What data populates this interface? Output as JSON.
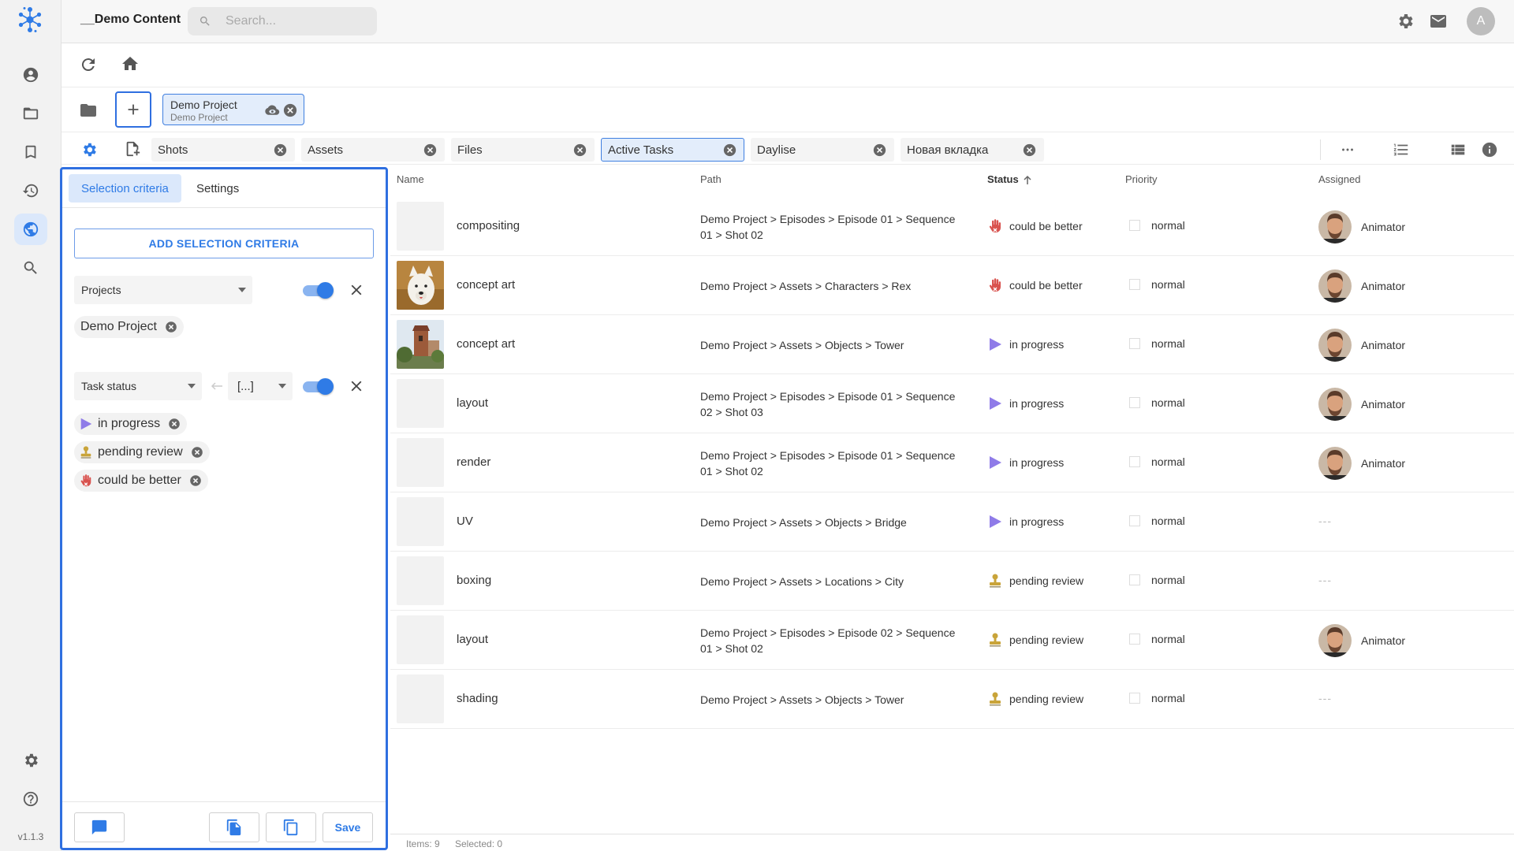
{
  "app": {
    "title": "__Demo Content",
    "version": "v1.1.3",
    "avatar_initial": "A",
    "accent": "#2f7be6"
  },
  "search": {
    "placeholder": "Search..."
  },
  "project_chip": {
    "name": "Demo Project",
    "subtitle": "Demo Project"
  },
  "tabs": [
    {
      "label": "Shots",
      "active": false
    },
    {
      "label": "Assets",
      "active": false
    },
    {
      "label": "Files",
      "active": false
    },
    {
      "label": "Active Tasks",
      "active": true
    },
    {
      "label": "Daylise",
      "active": false
    },
    {
      "label": "Новая вкладка",
      "active": false
    }
  ],
  "panel": {
    "tabs": [
      {
        "label": "Selection criteria",
        "active": true
      },
      {
        "label": "Settings",
        "active": false
      }
    ],
    "add_button": "ADD SELECTION CRITERIA",
    "criteria": [
      {
        "field": "Projects",
        "enabled": true,
        "values": [
          "Demo Project"
        ]
      },
      {
        "field": "Task status",
        "operator": "[...]",
        "enabled": true,
        "values": [
          "in progress",
          "pending review",
          "could be better"
        ]
      }
    ],
    "save_label": "Save"
  },
  "table": {
    "columns": {
      "name": "Name",
      "path": "Path",
      "status": "Status",
      "priority": "Priority",
      "assigned": "Assigned"
    },
    "sorted_by": "Status",
    "rows": [
      {
        "name": "compositing",
        "thumb": "none",
        "path": [
          "Demo Project > Episodes > Episode 01 > Sequence",
          "01 > Shot 02"
        ],
        "status": "could be better",
        "status_icon": "hand-icon",
        "priority": "normal",
        "assigned": "Animator"
      },
      {
        "name": "concept art",
        "thumb": "dog",
        "path": [
          "Demo Project > Assets > Characters > Rex"
        ],
        "status": "could be better",
        "status_icon": "hand-icon",
        "priority": "normal",
        "assigned": "Animator"
      },
      {
        "name": "concept art",
        "thumb": "tower",
        "path": [
          "Demo Project > Assets > Objects > Tower"
        ],
        "status": "in progress",
        "status_icon": "play-icon",
        "priority": "normal",
        "assigned": "Animator"
      },
      {
        "name": "layout",
        "thumb": "none",
        "path": [
          "Demo Project > Episodes > Episode 01 > Sequence",
          "02 > Shot 03"
        ],
        "status": "in progress",
        "status_icon": "play-icon",
        "priority": "normal",
        "assigned": "Animator"
      },
      {
        "name": "render",
        "thumb": "none",
        "path": [
          "Demo Project > Episodes > Episode 01 > Sequence",
          "01 > Shot 02"
        ],
        "status": "in progress",
        "status_icon": "play-icon",
        "priority": "normal",
        "assigned": "Animator"
      },
      {
        "name": "UV",
        "thumb": "none",
        "path": [
          "Demo Project > Assets > Objects > Bridge"
        ],
        "status": "in progress",
        "status_icon": "play-icon",
        "priority": "normal",
        "assigned": "---"
      },
      {
        "name": "boxing",
        "thumb": "none",
        "path": [
          "Demo Project > Assets > Locations > City"
        ],
        "status": "pending review",
        "status_icon": "stamp-icon",
        "priority": "normal",
        "assigned": "---"
      },
      {
        "name": "layout",
        "thumb": "none",
        "path": [
          "Demo Project > Episodes > Episode 02 > Sequence",
          "01 > Shot 02"
        ],
        "status": "pending review",
        "status_icon": "stamp-icon",
        "priority": "normal",
        "assigned": "Animator"
      },
      {
        "name": "shading",
        "thumb": "none",
        "path": [
          "Demo Project > Assets > Objects > Tower"
        ],
        "status": "pending review",
        "status_icon": "stamp-icon",
        "priority": "normal",
        "assigned": "---"
      }
    ]
  },
  "statusbar": {
    "items": "Items: 9",
    "selected": "Selected: 0"
  },
  "colors": {
    "in_progress": "#8f7be8",
    "pending_review": "#c9a43a",
    "could_be_better": "#d9534f"
  }
}
